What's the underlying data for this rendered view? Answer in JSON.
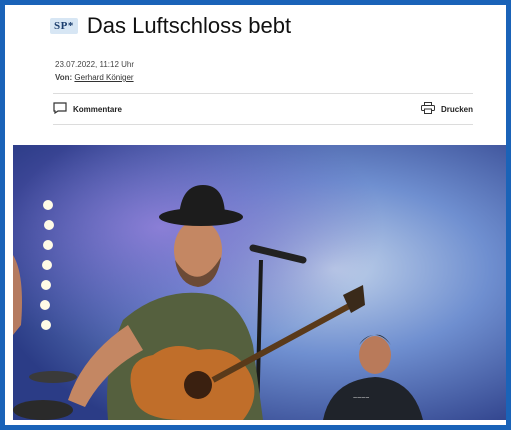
{
  "article": {
    "badge": "SP*",
    "title": "Das Luftschloss bebt",
    "date": "23.07.2022, 11:12 Uhr",
    "author_prefix": "Von:",
    "author_name": "Gerhard Königer"
  },
  "actions": {
    "comments_label": "Kommentare",
    "comments_icon": "comment-icon",
    "print_label": "Drucken",
    "print_icon": "printer-icon"
  },
  "photo": {
    "subject": "concert-performer-photo"
  },
  "colors": {
    "frame": "#1a63b8",
    "badge_bg": "#d7e6f4",
    "stage_blue": "#4d6fc0"
  }
}
